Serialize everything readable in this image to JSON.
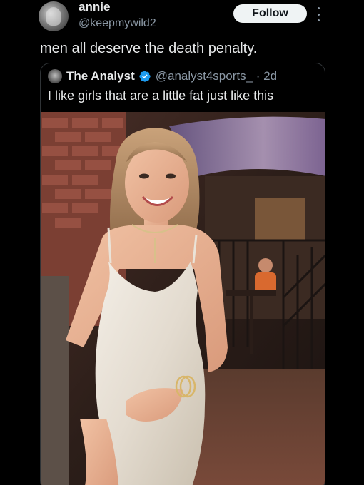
{
  "post": {
    "display_name": "annie",
    "handle": "@keepmywild2",
    "follow_label": "Follow",
    "text": "men all deserve the death penalty."
  },
  "quote": {
    "display_name": "The Analyst",
    "handle_time": "@analyst4sports_ · 2d",
    "text": "I like girls that are a little fat just like this"
  },
  "colors": {
    "background": "#000000",
    "primary_text": "#e7e9ea",
    "secondary_text": "#8b98a5",
    "follow_bg": "#eff3f4",
    "verified": "#1d9bf0"
  },
  "icons": {
    "more": "more-vertical-icon",
    "verified": "verified-badge-icon"
  }
}
